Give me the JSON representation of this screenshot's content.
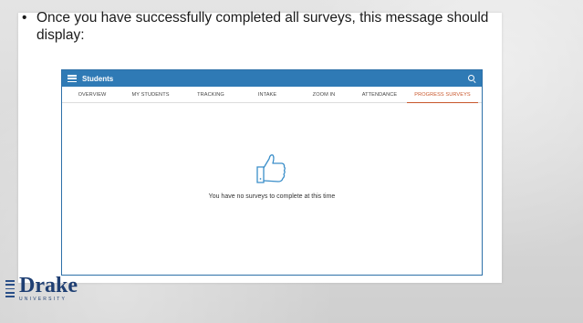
{
  "slide": {
    "bullet": "Once you have successfully completed all surveys, this message should display:"
  },
  "app": {
    "title": "Students",
    "tabs": [
      {
        "label": "OVERVIEW"
      },
      {
        "label": "MY STUDENTS"
      },
      {
        "label": "TRACKING"
      },
      {
        "label": "INTAKE"
      },
      {
        "label": "ZOOM IN"
      },
      {
        "label": "ATTENDANCE"
      },
      {
        "label": "PROGRESS SURVEYS"
      }
    ],
    "active_tab": "PROGRESS SURVEYS",
    "empty_message": "You have no surveys to complete at this time",
    "colors": {
      "topbar": "#2f7ab5",
      "active_tab": "#c8562b"
    }
  },
  "logo": {
    "name": "Drake",
    "subtitle": "UNIVERSITY"
  }
}
